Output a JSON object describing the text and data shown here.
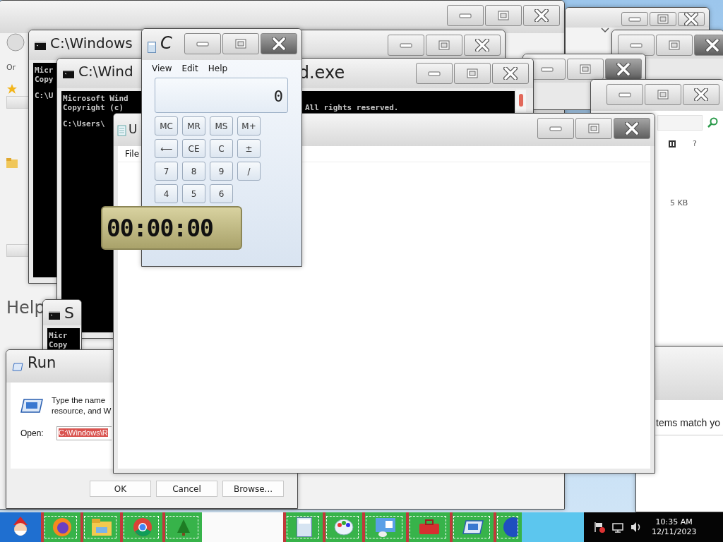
{
  "explorer_window": {
    "nav_text": "Or",
    "help_heading": "Help"
  },
  "search_window": {
    "help_glyph": "?",
    "size_text": "5 KB"
  },
  "results_window": {
    "message": "tems match yo"
  },
  "console_windows": [
    {
      "title": "C:\\Windows",
      "lines": [
        "Micr",
        "Copy"
      ],
      "prompt": "C:\\U"
    },
    {
      "title": "C:\\Wind",
      "title_tail": "d.exe",
      "lines": [
        "Microsoft Wind",
        "Copyright (c)"
      ],
      "right_text": "All rights reserved.",
      "prompt": "C:\\Users\\"
    },
    {
      "title": "S",
      "lines": [
        "Micr",
        "Copy"
      ]
    }
  ],
  "run_dialog": {
    "title": "Run",
    "description": [
      "Type the name",
      "resource, and W"
    ],
    "open_label": "Open:",
    "open_value": "C:\\Windows\\R",
    "buttons": [
      "OK",
      "Cancel",
      "Browse..."
    ]
  },
  "notepad": {
    "title": "U",
    "menu": [
      "File"
    ]
  },
  "calculator": {
    "title": "C",
    "menu": [
      "View",
      "Edit",
      "Help"
    ],
    "display": "0",
    "keys": [
      [
        "MC",
        "MR",
        "MS",
        "M+"
      ],
      [
        "⟵",
        "CE",
        "C",
        "±"
      ],
      [
        "7",
        "8",
        "9",
        "/"
      ],
      [
        "4",
        "5",
        "6"
      ]
    ]
  },
  "stopwatch": {
    "time": "00:00:00"
  },
  "taskbar": {
    "time": "10:35 AM",
    "date": "12/11/2023"
  }
}
